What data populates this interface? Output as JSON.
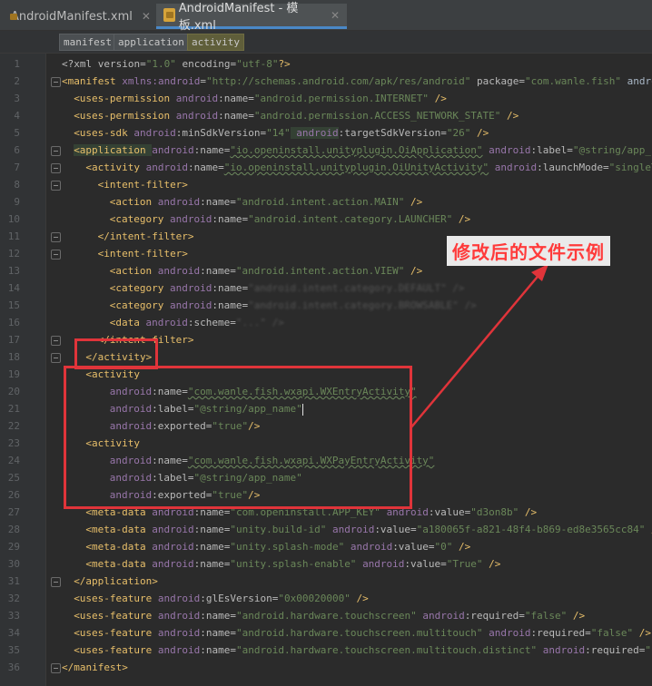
{
  "tabs": [
    {
      "label": "AndroidManifest.xml",
      "active": false
    },
    {
      "label": "AndroidManifest - 模板.xml",
      "active": true
    }
  ],
  "breadcrumb": [
    "manifest",
    "application",
    "activity"
  ],
  "line_numbers": [
    "1",
    "2",
    "3",
    "4",
    "5",
    "6",
    "7",
    "8",
    "9",
    "10",
    "11",
    "12",
    "13",
    "14",
    "15",
    "16",
    "17",
    "18",
    "19",
    "20",
    "21",
    "22",
    "23",
    "24",
    "25",
    "26",
    "27",
    "28",
    "29",
    "30",
    "31",
    "32",
    "33",
    "34",
    "35",
    "36"
  ],
  "annotation": {
    "text": "修改后的文件示例",
    "color": "#e0343a"
  },
  "code": {
    "l1": [
      "<?xml version=",
      "\"1.0\"",
      " encoding=",
      "\"utf-8\"",
      "?>"
    ],
    "l2": [
      "<manifest ",
      "xmlns:",
      "android",
      "=",
      "\"http://schemas.android.com/apk/res/android\"",
      " package=",
      "\"com.wanle.fish\"",
      " android:versio"
    ],
    "l3": [
      "<uses-permission ",
      "android",
      ":name=",
      "\"android.permission.INTERNET\"",
      " />"
    ],
    "l4": [
      "<uses-permission ",
      "android",
      ":name=",
      "\"android.permission.ACCESS_NETWORK_STATE\"",
      " />"
    ],
    "l5": [
      "<uses-sdk ",
      "android",
      ":minSdkVersion=",
      "\"14\"",
      " ",
      "android",
      ":targetSdkVersion=",
      "\"26\"",
      " />"
    ],
    "l6": [
      "<application ",
      "android",
      ":name=",
      "\"io.openinstall.unityplugin.OiApplication\"",
      " ",
      "android",
      ":label=",
      "\"@string/app_name\"",
      " andro"
    ],
    "l7": [
      "<activity ",
      "android",
      ":name=",
      "\"io.openinstall.unityplugin.OiUnityActivity\"",
      " ",
      "android",
      ":launchMode=",
      "\"singleTask\"",
      " andro"
    ],
    "l8": [
      "<intent-filter>"
    ],
    "l9": [
      "<action ",
      "android",
      ":name=",
      "\"android.intent.action.MAIN\"",
      " />"
    ],
    "l10": [
      "<category ",
      "android",
      ":name=",
      "\"android.intent.category.LAUNCHER\"",
      " />"
    ],
    "l11": [
      "</intent-filter>"
    ],
    "l12": [
      "<intent-filter>"
    ],
    "l13": [
      "<action ",
      "android",
      ":name=",
      "\"android.intent.action.VIEW\"",
      " />"
    ],
    "l14": [
      "<category ",
      "android",
      ":name=",
      "\"android.intent.category.DEFAULT\"",
      " />"
    ],
    "l15": [
      "<category ",
      "android",
      ":name=",
      "\"android.intent.category.BROWSABLE\"",
      " />"
    ],
    "l16": [
      "<data ",
      "android",
      ":scheme=",
      "\"...\"",
      " />"
    ],
    "l17": [
      "</intent-filter>"
    ],
    "l18": [
      "</activity>"
    ],
    "l19": [
      "<activity"
    ],
    "l20": [
      "android",
      ":name=",
      "\"com.wanle.fish.wxapi.WXEntryActivity\""
    ],
    "l21": [
      "android",
      ":label=",
      "\"@string/app_name\""
    ],
    "l22": [
      "android",
      ":exported=",
      "\"true\"",
      "/>"
    ],
    "l23": [
      "<activity"
    ],
    "l24": [
      "android",
      ":name=",
      "\"com.wanle.fish.wxapi.WXPayEntryActivity\""
    ],
    "l25": [
      "android",
      ":label=",
      "\"@string/app_name\""
    ],
    "l26": [
      "android",
      ":exported=",
      "\"true\"",
      "/>"
    ],
    "l27": [
      "<meta-data ",
      "android",
      ":name=",
      "\"com.openinstall.APP_KEY\"",
      " ",
      "android",
      ":value=",
      "\"d3on8b\"",
      " />"
    ],
    "l28": [
      "<meta-data ",
      "android",
      ":name=",
      "\"unity.build-id\"",
      " ",
      "android",
      ":value=",
      "\"a180065f-a821-48f4-b869-ed8e3565cc84\"",
      " />"
    ],
    "l29": [
      "<meta-data ",
      "android",
      ":name=",
      "\"unity.splash-mode\"",
      " ",
      "android",
      ":value=",
      "\"0\"",
      " />"
    ],
    "l30": [
      "<meta-data ",
      "android",
      ":name=",
      "\"unity.splash-enable\"",
      " ",
      "android",
      ":value=",
      "\"True\"",
      " />"
    ],
    "l31": [
      "</application>"
    ],
    "l32": [
      "<uses-feature ",
      "android",
      ":glEsVersion=",
      "\"0x00020000\"",
      " />"
    ],
    "l33": [
      "<uses-feature ",
      "android",
      ":name=",
      "\"android.hardware.touchscreen\"",
      " ",
      "android",
      ":required=",
      "\"false\"",
      " />"
    ],
    "l34": [
      "<uses-feature ",
      "android",
      ":name=",
      "\"android.hardware.touchscreen.multitouch\"",
      " ",
      "android",
      ":required=",
      "\"false\"",
      " />"
    ],
    "l35": [
      "<uses-feature ",
      "android",
      ":name=",
      "\"android.hardware.touchscreen.multitouch.distinct\"",
      " ",
      "android",
      ":required=",
      "\"false\"",
      " />"
    ],
    "l36": [
      "</manifest>"
    ]
  }
}
